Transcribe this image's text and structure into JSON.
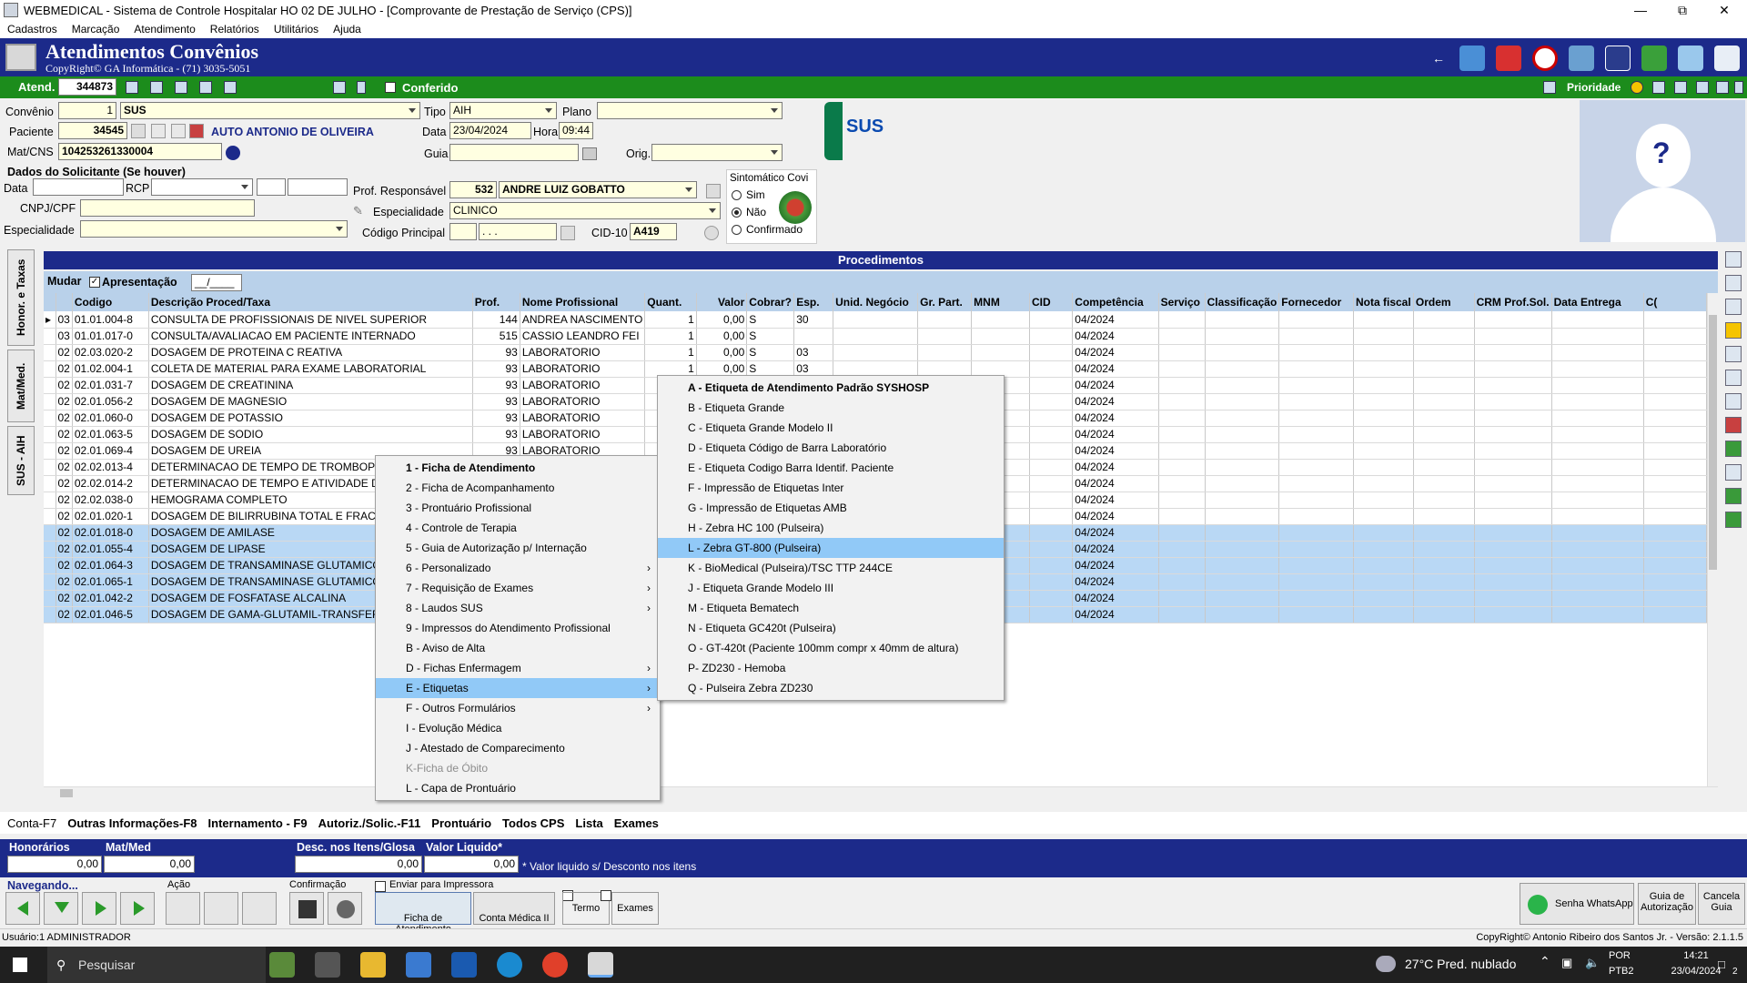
{
  "window": {
    "title": "WEBMEDICAL - Sistema de Controle Hospitalar HO 02 DE JULHO - [Comprovante de Prestação de Serviço  (CPS)]"
  },
  "menu": [
    "Cadastros",
    "Marcação",
    "Atendimento",
    "Relatórios",
    "Utilitários",
    "Ajuda"
  ],
  "banner": {
    "title": "Atendimentos Convênios",
    "subtitle": "CopyRight© GA Informática - (71) 3035-5051"
  },
  "topbar": {
    "atend_label": "Atend.",
    "atend_value": "344873",
    "conferido_label": "Conferido",
    "prioridade_label": "Prioridade"
  },
  "form": {
    "convenio_label": "Convênio",
    "convenio_code": "1",
    "convenio_name": "SUS",
    "tipo_label": "Tipo",
    "tipo_value": "AIH",
    "plano_label": "Plano",
    "plano_value": "",
    "paciente_label": "Paciente",
    "paciente_code": "34545",
    "paciente_name": "AUTO ANTONIO DE OLIVEIRA",
    "data_label": "Data",
    "data_value": "23/04/2024",
    "hora_label": "Hora",
    "hora_value": "09:44",
    "matcns_label": "Mat/CNS",
    "matcns_value": "104253261330004",
    "guia_label": "Guia",
    "guia_value": "",
    "orig_label": "Orig.",
    "orig_value": "",
    "solicitante_title": "Dados do Solicitante (Se houver)",
    "sol_data_label": "Data",
    "sol_rcp_label": "RCP",
    "cnpj_label": "CNPJ/CPF",
    "esp_label": "Especialidade",
    "prof_label": "Prof. Responsável",
    "prof_code": "532",
    "prof_name": "ANDRE LUIZ GOBATTO",
    "especialidade_label": "Especialidade",
    "especialidade_value": "CLINICO",
    "codigo_label": "Código Principal",
    "codigo_value": ". . .",
    "cid_label": "CID-10",
    "cid_value": "A419",
    "sintomatico_label": "Sintomático Covi",
    "radio_sim": "Sim",
    "radio_nao": "Não",
    "radio_conf": "Confirmado",
    "sus_logo": "SUS"
  },
  "procedimentos": {
    "header": "Procedimentos",
    "mudar_label": "Mudar",
    "apresentacao_label": "Apresentação",
    "apresentacao_value": "__/____",
    "columns": [
      "Codigo",
      "Descrição Proced/Taxa",
      "Prof.",
      "Nome Profissional",
      "Quant.",
      "Valor",
      "Cobrar?",
      "Esp.",
      "Unid. Negócio",
      "Gr. Part.",
      "MNM",
      "CID",
      "Competência",
      "Serviço",
      "Classificação",
      "Fornecedor",
      "Nota fiscal",
      "Ordem",
      "CRM Prof.Sol.",
      "Data Entrega",
      "C("
    ],
    "rows": [
      [
        "03",
        "01.01.004-8",
        "CONSULTA DE PROFISSIONAIS DE NIVEL SUPERIOR",
        "144",
        "ANDREA NASCIMENTO",
        "1",
        "0,00",
        "S",
        "30",
        "04/2024"
      ],
      [
        "03",
        "01.01.017-0",
        "CONSULTA/AVALIACAO EM PACIENTE INTERNADO",
        "515",
        "CASSIO LEANDRO FEI",
        "1",
        "0,00",
        "S",
        "",
        "04/2024"
      ],
      [
        "02",
        "02.03.020-2",
        "DOSAGEM DE PROTEINA C REATIVA",
        "93",
        "LABORATORIO",
        "1",
        "0,00",
        "S",
        "03",
        "04/2024"
      ],
      [
        "02",
        "01.02.004-1",
        "COLETA DE MATERIAL PARA EXAME LABORATORIAL",
        "93",
        "LABORATORIO",
        "1",
        "0,00",
        "S",
        "03",
        "04/2024"
      ],
      [
        "02",
        "02.01.031-7",
        "DOSAGEM DE CREATININA",
        "93",
        "LABORATORIO",
        "1",
        "",
        "",
        "",
        "04/2024"
      ],
      [
        "02",
        "02.01.056-2",
        "DOSAGEM DE MAGNESIO",
        "93",
        "LABORATORIO",
        "1",
        "",
        "",
        "",
        "04/2024"
      ],
      [
        "02",
        "02.01.060-0",
        "DOSAGEM DE POTASSIO",
        "93",
        "LABORATORIO",
        "1",
        "",
        "",
        "",
        "04/2024"
      ],
      [
        "02",
        "02.01.063-5",
        "DOSAGEM DE SODIO",
        "93",
        "LABORATORIO",
        "1",
        "",
        "",
        "",
        "04/2024"
      ],
      [
        "02",
        "02.01.069-4",
        "DOSAGEM DE UREIA",
        "93",
        "LABORATORIO",
        "1",
        "",
        "",
        "",
        "04/2024"
      ],
      [
        "02",
        "02.02.013-4",
        "DETERMINACAO DE TEMPO DE TROMBOPLASTINA",
        "",
        "",
        "",
        "",
        "",
        "",
        "04/2024"
      ],
      [
        "02",
        "02.02.014-2",
        "DETERMINACAO DE TEMPO E ATIVIDADE DA PROTROMBINA",
        "",
        "",
        "",
        "",
        "",
        "",
        "04/2024"
      ],
      [
        "02",
        "02.02.038-0",
        "HEMOGRAMA COMPLETO",
        "",
        "",
        "",
        "",
        "",
        "",
        "04/2024"
      ],
      [
        "02",
        "02.01.020-1",
        "DOSAGEM DE BILIRRUBINA TOTAL E FRACOES",
        "",
        "",
        "",
        "",
        "",
        "",
        "04/2024"
      ],
      [
        "02",
        "02.01.018-0",
        "DOSAGEM DE AMILASE",
        "",
        "",
        "",
        "",
        "",
        "",
        "04/2024"
      ],
      [
        "02",
        "02.01.055-4",
        "DOSAGEM DE LIPASE",
        "",
        "",
        "",
        "",
        "",
        "",
        "04/2024"
      ],
      [
        "02",
        "02.01.064-3",
        "DOSAGEM DE TRANSAMINASE GLUTAMICO-OXALACETICA",
        "",
        "",
        "",
        "",
        "",
        "",
        "04/2024"
      ],
      [
        "02",
        "02.01.065-1",
        "DOSAGEM DE TRANSAMINASE GLUTAMICO-PIRUVICA",
        "",
        "",
        "",
        "",
        "",
        "",
        "04/2024"
      ],
      [
        "02",
        "02.01.042-2",
        "DOSAGEM DE FOSFATASE ALCALINA",
        "",
        "",
        "",
        "",
        "",
        "",
        "04/2024"
      ],
      [
        "02",
        "02.01.046-5",
        "DOSAGEM DE GAMA-GLUTAMIL-TRANSFERASE",
        "",
        "",
        "",
        "",
        "",
        "",
        "04/2024"
      ]
    ]
  },
  "context_menu": {
    "items": [
      {
        "label": "1 - Ficha de Atendimento",
        "bold": true
      },
      {
        "label": "2 - Ficha de Acompanhamento"
      },
      {
        "label": "3 - Prontuário Profissional"
      },
      {
        "label": "4 - Controle de Terapia"
      },
      {
        "label": "5 - Guia de Autorização p/ Internação"
      },
      {
        "label": "6 - Personalizado",
        "sub": true
      },
      {
        "label": "7 - Requisição de Exames",
        "sub": true
      },
      {
        "label": "8 - Laudos SUS",
        "sub": true
      },
      {
        "label": "9 - Impressos do Atendimento Profissional"
      },
      {
        "label": "B - Aviso de Alta"
      },
      {
        "label": "D - Fichas Enfermagem",
        "sub": true
      },
      {
        "label": "E - Etiquetas",
        "sub": true,
        "highlight": true
      },
      {
        "label": "F - Outros Formulários",
        "sub": true
      },
      {
        "label": "I - Evolução Médica"
      },
      {
        "label": "J - Atestado de Comparecimento"
      },
      {
        "label": "K-Ficha de Óbito",
        "disabled": true
      },
      {
        "label": "L - Capa de Prontuário"
      }
    ]
  },
  "submenu": {
    "items": [
      {
        "label": "A - Etiqueta de Atendimento Padrão SYSHOSP",
        "bold": true
      },
      {
        "label": "B - Etiqueta Grande"
      },
      {
        "label": "C - Etiqueta Grande Modelo II"
      },
      {
        "label": "D - Etiqueta Código de Barra Laboratório"
      },
      {
        "label": "E - Etiqueta Codigo Barra Identif. Paciente"
      },
      {
        "label": "F - Impressão de Etiquetas Inter"
      },
      {
        "label": "G - Impressão de Etiquetas AMB"
      },
      {
        "label": "H - Zebra HC 100 (Pulseira)"
      },
      {
        "label": "L - Zebra GT-800 (Pulseira)",
        "highlight": true
      },
      {
        "label": "K - BioMedical (Pulseira)/TSC TTP 244CE"
      },
      {
        "label": "J - Etiqueta Grande Modelo III"
      },
      {
        "label": "M - Etiqueta Bematech"
      },
      {
        "label": "N - Etiqueta GC420t (Pulseira)"
      },
      {
        "label": "O - GT-420t (Paciente 100mm compr x 40mm de altura)"
      },
      {
        "label": "P- ZD230 - Hemoba"
      },
      {
        "label": "Q - Pulseira Zebra ZD230"
      }
    ]
  },
  "side_tabs": [
    "Honor. e Taxas",
    "Mat/Med.",
    "SUS - AIH"
  ],
  "bottom_tabs": [
    "Conta-F7",
    "Outras Informações-F8",
    "Internamento - F9",
    "Autoriz./Solic.-F11",
    "Prontuário",
    "Todos CPS",
    "Lista",
    "Exames"
  ],
  "totals": {
    "honorarios_label": "Honorários",
    "honorarios_value": "0,00",
    "matmed_label": "Mat/Med",
    "matmed_value": "0,00",
    "desc_label": "Desc. nos Itens/Glosa",
    "desc_value": "0,00",
    "liquido_label": "Valor Liquido*",
    "liquido_value": "0,00",
    "note": "* Valor liquido s/ Desconto nos itens"
  },
  "nav": {
    "navegando_label": "Navegando...",
    "acao_label": "Ação",
    "confirmacao_label": "Confirmação",
    "enviar_label": "Enviar para Impressora",
    "ficha_label": "Ficha de Atendimento",
    "conta_label": "Conta Médica II",
    "termo_label": "Termo",
    "exames_label": "Exames",
    "whatsapp_label": "Senha WhatsApp",
    "guia_aut_label": "Guia de Autorização",
    "cancela_label": "Cancela Guia"
  },
  "status": {
    "user": "Usuário:1 ADMINISTRADOR",
    "copyright": "CopyRight© Antonio Ribeiro dos Santos Jr. - Versão: 2.1.1.5"
  },
  "taskbar": {
    "search": "Pesquisar",
    "weather": "27°C  Pred. nublado",
    "lang1": "POR",
    "lang2": "PTB2",
    "time": "14:21",
    "date": "23/04/2024",
    "notif": "2"
  },
  "colors": {
    "banner": "#1c2a8a",
    "green": "#1c8c1c",
    "field": "#ffffe1",
    "highlight": "#91c9f7"
  }
}
